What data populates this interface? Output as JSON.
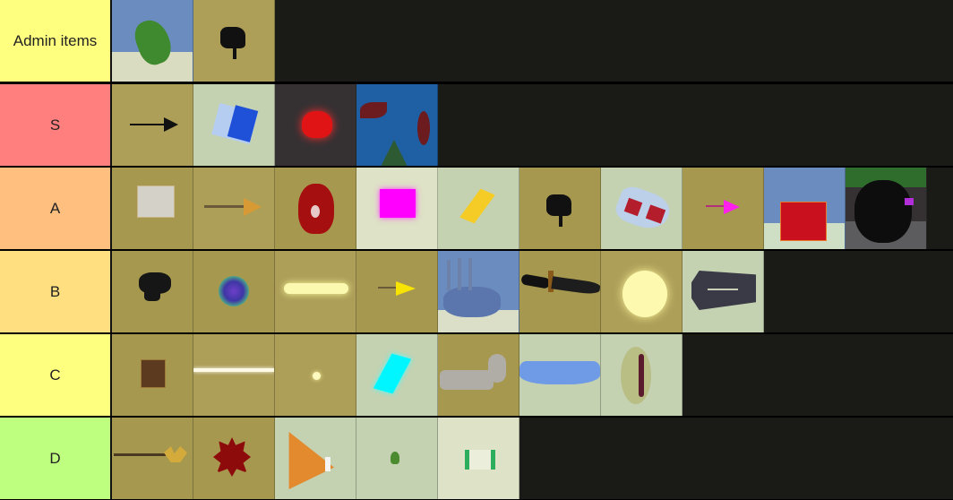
{
  "tiers": [
    {
      "label": "Admin items",
      "color": "#ffff7f",
      "items": [
        {
          "name": "frog",
          "bg": "blue"
        },
        {
          "name": "black-glove",
          "bg": "olive"
        }
      ]
    },
    {
      "label": "S",
      "color": "#ff7f7f",
      "items": [
        {
          "name": "black-arrow",
          "bg": "olive"
        },
        {
          "name": "blue-white-box",
          "bg": "mint"
        },
        {
          "name": "red-heart",
          "bg": "dark"
        },
        {
          "name": "blue-red-pattern",
          "bg": "sky"
        }
      ]
    },
    {
      "label": "A",
      "color": "#ffbf7f",
      "items": [
        {
          "name": "white-box",
          "bg": "olive2"
        },
        {
          "name": "gold-arrow",
          "bg": "olive"
        },
        {
          "name": "red-cap",
          "bg": "olive2"
        },
        {
          "name": "magenta-box",
          "bg": "cream"
        },
        {
          "name": "yellow-gem",
          "bg": "mint"
        },
        {
          "name": "black-glove",
          "bg": "olive2"
        },
        {
          "name": "red-white-shoe",
          "bg": "mint"
        },
        {
          "name": "pink-arrow",
          "bg": "olive2"
        },
        {
          "name": "red-box",
          "bg": "blue"
        },
        {
          "name": "black-shadow-figure",
          "bg": "dark"
        }
      ]
    },
    {
      "label": "B",
      "color": "#ffdf7f",
      "items": [
        {
          "name": "black-cap",
          "bg": "olive2"
        },
        {
          "name": "purple-orb",
          "bg": "olive2"
        },
        {
          "name": "glowing-arm",
          "bg": "olive"
        },
        {
          "name": "yellow-arrow",
          "bg": "olive2"
        },
        {
          "name": "claw-glove",
          "bg": "blue"
        },
        {
          "name": "knife",
          "bg": "olive2"
        },
        {
          "name": "glowing-sphere",
          "bg": "olive"
        },
        {
          "name": "coffin",
          "bg": "mint"
        }
      ]
    },
    {
      "label": "C",
      "color": "#ffff7f",
      "items": [
        {
          "name": "brown-box",
          "bg": "olive2"
        },
        {
          "name": "light-beam",
          "bg": "olive"
        },
        {
          "name": "small-light",
          "bg": "olive"
        },
        {
          "name": "cyan-gem",
          "bg": "mint"
        },
        {
          "name": "grey-arm",
          "bg": "olive2"
        },
        {
          "name": "blue-skirt",
          "bg": "mint"
        },
        {
          "name": "straw-hat",
          "bg": "mint"
        }
      ]
    },
    {
      "label": "D",
      "color": "#bfff7f",
      "items": [
        {
          "name": "trident",
          "bg": "olive2"
        },
        {
          "name": "red-splat",
          "bg": "olive2"
        },
        {
          "name": "traffic-cone",
          "bg": "mint"
        },
        {
          "name": "green-leaf",
          "bg": "mint"
        },
        {
          "name": "green-white-band",
          "bg": "cream"
        }
      ]
    }
  ]
}
